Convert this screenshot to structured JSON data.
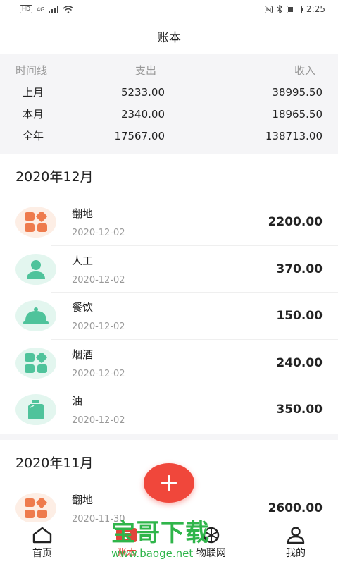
{
  "status_bar": {
    "left": "HD",
    "network": "4G",
    "time": "2:25",
    "battery_level": 0.35
  },
  "header": {
    "title": "账本"
  },
  "summary": {
    "columns": [
      "时间线",
      "支出",
      "收入"
    ],
    "rows": [
      {
        "label": "上月",
        "expense": "5233.00",
        "income": "38995.50"
      },
      {
        "label": "本月",
        "expense": "2340.00",
        "income": "18965.50"
      },
      {
        "label": "全年",
        "expense": "17567.00",
        "income": "138713.00"
      }
    ]
  },
  "months": [
    {
      "title": "2020年12月",
      "entries": [
        {
          "name": "翻地",
          "date": "2020-12-02",
          "amount": "2200.00",
          "icon": "grid-icon",
          "color": "#ee7b4d"
        },
        {
          "name": "人工",
          "date": "2020-12-02",
          "amount": "370.00",
          "icon": "person-icon",
          "color": "#4fc39b"
        },
        {
          "name": "餐饮",
          "date": "2020-12-02",
          "amount": "150.00",
          "icon": "food-cover-icon",
          "color": "#4fc39b"
        },
        {
          "name": "烟酒",
          "date": "2020-12-02",
          "amount": "240.00",
          "icon": "grid-icon",
          "color": "#4fc39b"
        },
        {
          "name": "油",
          "date": "2020-12-02",
          "amount": "350.00",
          "icon": "oil-can-icon",
          "color": "#4fc39b"
        }
      ]
    },
    {
      "title": "2020年11月",
      "entries": [
        {
          "name": "翻地",
          "date": "2020-11-30",
          "amount": "2600.00",
          "icon": "grid-icon",
          "color": "#ee7b4d"
        }
      ]
    }
  ],
  "fab": {
    "icon": "plus-icon",
    "color": "#f0473b"
  },
  "tabs": [
    {
      "label": "首页",
      "icon": "home-icon",
      "active": false
    },
    {
      "label": "账本",
      "icon": "ledger-icon",
      "active": true
    },
    {
      "label": "物联网",
      "icon": "iot-icon",
      "active": false
    },
    {
      "label": "我的",
      "icon": "user-icon",
      "active": false
    }
  ],
  "watermark": {
    "main": "宝哥下载",
    "url": "www.baoge.net"
  }
}
